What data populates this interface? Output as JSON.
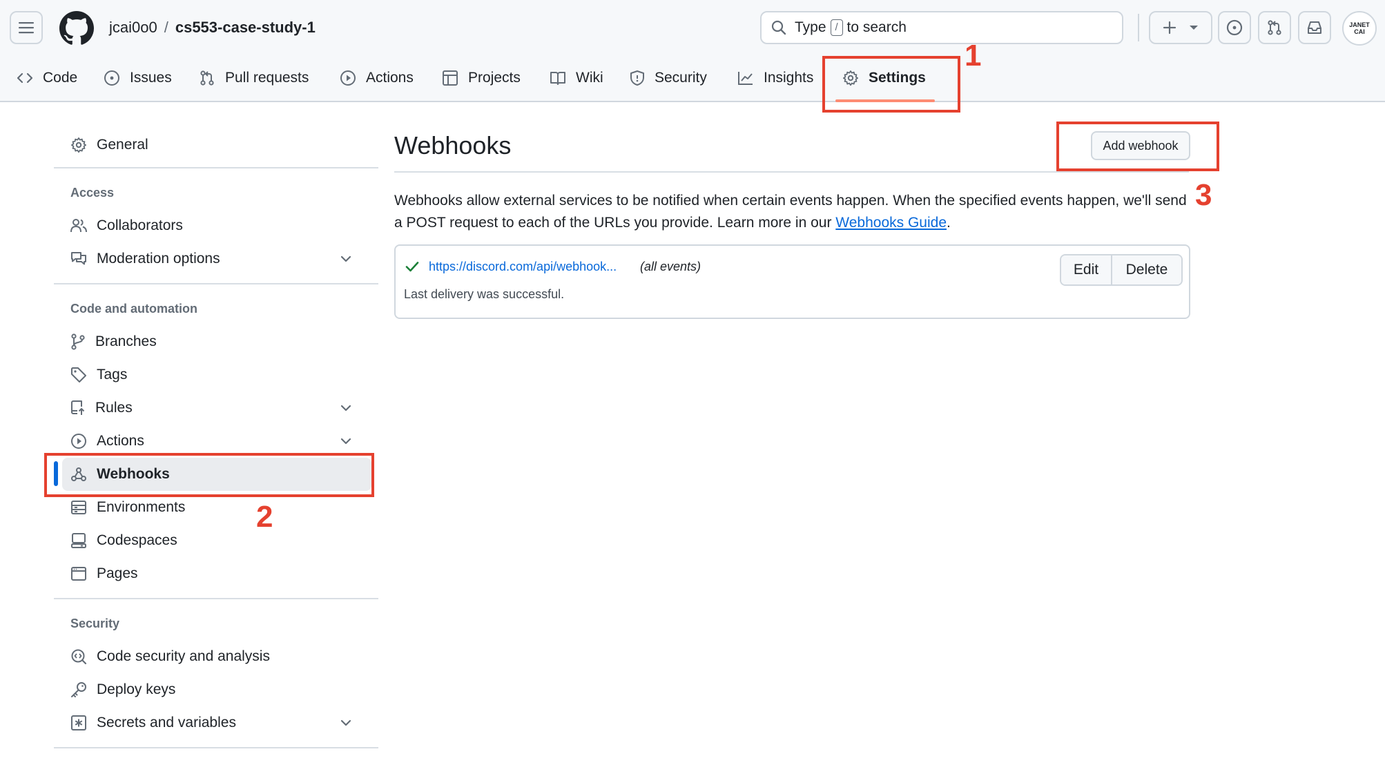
{
  "header": {
    "owner": "jcai0o0",
    "separator": "/",
    "repo": "cs553-case-study-1",
    "search": {
      "prefix": "Type",
      "key": "/",
      "suffix": "to search"
    },
    "avatar_text": "JANET CAI"
  },
  "tabs": [
    {
      "label": "Code",
      "icon": "code-icon"
    },
    {
      "label": "Issues",
      "icon": "issue-icon"
    },
    {
      "label": "Pull requests",
      "icon": "pull-request-icon"
    },
    {
      "label": "Actions",
      "icon": "play-icon"
    },
    {
      "label": "Projects",
      "icon": "table-icon"
    },
    {
      "label": "Wiki",
      "icon": "book-icon"
    },
    {
      "label": "Security",
      "icon": "shield-icon"
    },
    {
      "label": "Insights",
      "icon": "graph-icon"
    },
    {
      "label": "Settings",
      "icon": "gear-icon",
      "active": true
    }
  ],
  "sidebar": {
    "general": "General",
    "access_heading": "Access",
    "collaborators": "Collaborators",
    "moderation": "Moderation options",
    "code_heading": "Code and automation",
    "branches": "Branches",
    "tags": "Tags",
    "rules": "Rules",
    "actions": "Actions",
    "webhooks": "Webhooks",
    "environments": "Environments",
    "codespaces": "Codespaces",
    "pages": "Pages",
    "security_heading": "Security",
    "code_security": "Code security and analysis",
    "deploy_keys": "Deploy keys",
    "secrets": "Secrets and variables"
  },
  "main": {
    "title": "Webhooks",
    "add_button": "Add webhook",
    "description": "Webhooks allow external services to be notified when certain events happen. When the specified events happen, we'll send a POST request to each of the URLs you provide. Learn more in our ",
    "guide_link": "Webhooks Guide",
    "description_end": ".",
    "webhook": {
      "url": "https://discord.com/api/webhook...",
      "events": "(all events)",
      "status": "Last delivery was successful.",
      "edit_label": "Edit",
      "delete_label": "Delete"
    }
  },
  "annotations": {
    "one": "1",
    "two": "2",
    "three": "3"
  },
  "colors": {
    "annotation": "#e5412f",
    "link": "#0969da",
    "success": "#1a7f37",
    "active_indicator": "#0969da",
    "tab_underline": "#fd8c73"
  }
}
